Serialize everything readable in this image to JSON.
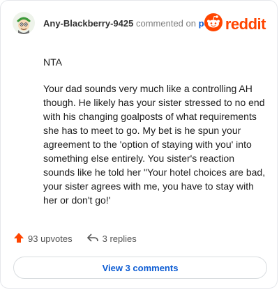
{
  "comment": {
    "author": "Any-Blackberry-9425",
    "action_text": "commented on",
    "post_link": "post",
    "brand": "reddit",
    "paragraphs": [
      "NTA",
      "Your dad sounds very much like a controlling AH though. He likely has your sister stressed to no end with his changing goalposts of what requirements she has to meet to go. My bet is he spun your agreement to the 'option of staying with you' into something else entirely. You sister's reaction sounds like he told her \"Your hotel choices are bad, your sister agrees with me, you have to stay with her or don't go!'"
    ]
  },
  "actions": {
    "upvotes": "93 upvotes",
    "replies": "3 replies"
  },
  "view_button": "View 3 comments",
  "colors": {
    "brand": "#ff4500",
    "link": "#0b5bd3"
  }
}
